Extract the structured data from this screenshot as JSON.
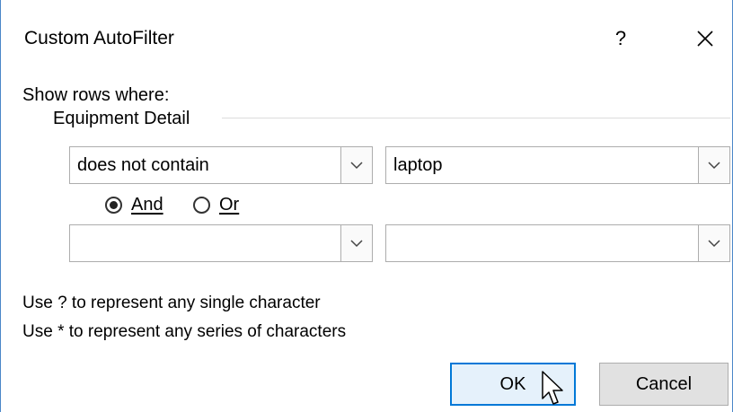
{
  "window": {
    "title": "Custom AutoFilter",
    "help_label": "?",
    "close_icon": "close-icon"
  },
  "criteria": {
    "show_rows_label": "Show rows where:",
    "field_name": "Equipment Detail",
    "row1": {
      "operator": "does not contain",
      "value": "laptop"
    },
    "logic": {
      "and_label": "And",
      "or_label": "Or",
      "selected": "And"
    },
    "row2": {
      "operator": "",
      "value": ""
    }
  },
  "hints": {
    "line1": "Use ? to represent any single character",
    "line2": "Use * to represent any series of characters"
  },
  "buttons": {
    "ok_label": "OK",
    "cancel_label": "Cancel"
  },
  "colors": {
    "window_border": "#4b87c8",
    "ok_focus_border": "#0078d7",
    "ok_background": "#e5f1fb",
    "cancel_background": "#e1e1e1"
  }
}
